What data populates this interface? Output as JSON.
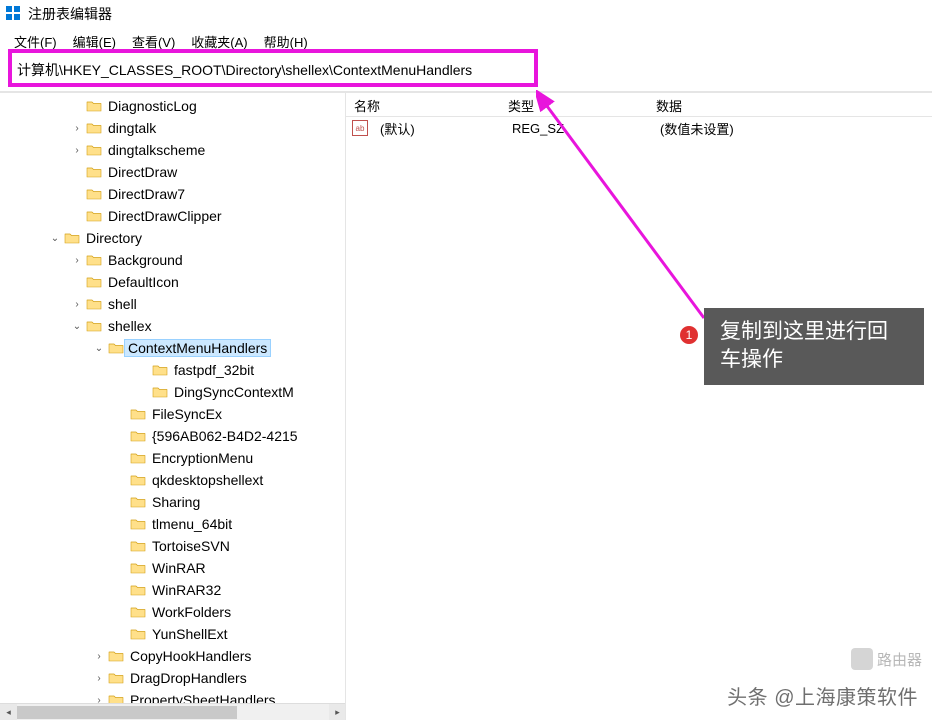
{
  "window": {
    "title": "注册表编辑器"
  },
  "menu": {
    "file": "文件(F)",
    "edit": "编辑(E)",
    "view": "查看(V)",
    "favorites": "收藏夹(A)",
    "help": "帮助(H)"
  },
  "address": {
    "path": "计算机\\HKEY_CLASSES_ROOT\\Directory\\shellex\\ContextMenuHandlers"
  },
  "tree": [
    {
      "indent": 3,
      "exp": "",
      "name": "DiagnosticLog"
    },
    {
      "indent": 3,
      "exp": ">",
      "name": "dingtalk"
    },
    {
      "indent": 3,
      "exp": ">",
      "name": "dingtalkscheme"
    },
    {
      "indent": 3,
      "exp": "",
      "name": "DirectDraw"
    },
    {
      "indent": 3,
      "exp": "",
      "name": "DirectDraw7"
    },
    {
      "indent": 3,
      "exp": "",
      "name": "DirectDrawClipper"
    },
    {
      "indent": 2,
      "exp": "v",
      "name": "Directory"
    },
    {
      "indent": 3,
      "exp": ">",
      "name": "Background"
    },
    {
      "indent": 3,
      "exp": "",
      "name": "DefaultIcon"
    },
    {
      "indent": 3,
      "exp": ">",
      "name": "shell"
    },
    {
      "indent": 3,
      "exp": "v",
      "name": "shellex"
    },
    {
      "indent": 4,
      "exp": "v",
      "name": "ContextMenuHandlers",
      "selected": true
    },
    {
      "indent": 5,
      "exp": "",
      "name": " fastpdf_32bit",
      "extra": true
    },
    {
      "indent": 5,
      "exp": "",
      "name": " DingSyncContextM",
      "extra": true
    },
    {
      "indent": 5,
      "exp": "",
      "name": " FileSyncEx"
    },
    {
      "indent": 5,
      "exp": "",
      "name": "{596AB062-B4D2-4215"
    },
    {
      "indent": 5,
      "exp": "",
      "name": "EncryptionMenu"
    },
    {
      "indent": 5,
      "exp": "",
      "name": "qkdesktopshellext"
    },
    {
      "indent": 5,
      "exp": "",
      "name": "Sharing"
    },
    {
      "indent": 5,
      "exp": "",
      "name": "tlmenu_64bit"
    },
    {
      "indent": 5,
      "exp": "",
      "name": "TortoiseSVN"
    },
    {
      "indent": 5,
      "exp": "",
      "name": "WinRAR"
    },
    {
      "indent": 5,
      "exp": "",
      "name": "WinRAR32"
    },
    {
      "indent": 5,
      "exp": "",
      "name": "WorkFolders"
    },
    {
      "indent": 5,
      "exp": "",
      "name": "YunShellExt"
    },
    {
      "indent": 4,
      "exp": ">",
      "name": "CopyHookHandlers"
    },
    {
      "indent": 4,
      "exp": ">",
      "name": "DragDropHandlers"
    },
    {
      "indent": 4,
      "exp": ">",
      "name": "PropertySheetHandlers"
    }
  ],
  "values": {
    "columns": {
      "name": "名称",
      "type": "类型",
      "data": "数据"
    },
    "rows": [
      {
        "name": "(默认)",
        "type": "REG_SZ",
        "data": "(数值未设置)"
      }
    ]
  },
  "callout": {
    "badge": "1",
    "text": "复制到这里进行回车操作"
  },
  "watermark": {
    "router": "路由器",
    "attribution": "头条 @上海康策软件"
  },
  "icons": {
    "string_value": "ab"
  }
}
